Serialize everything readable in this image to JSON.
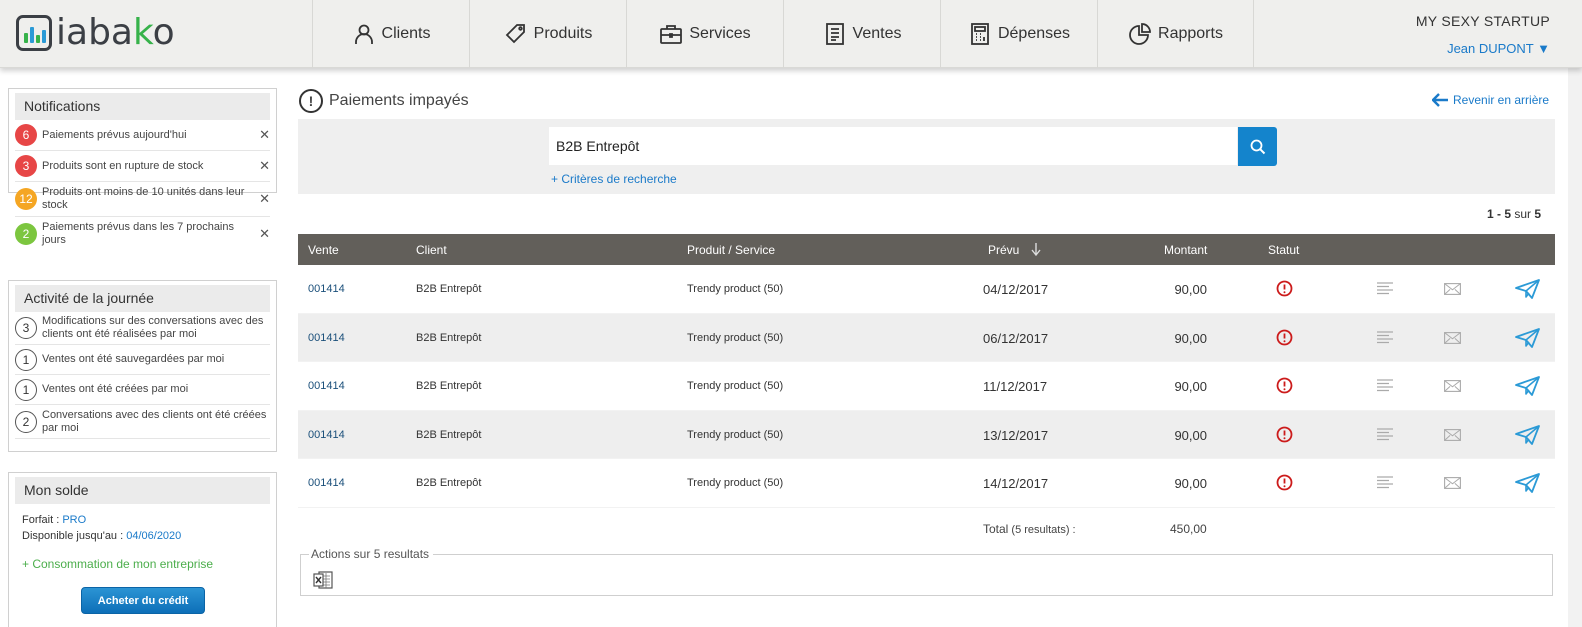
{
  "app": {
    "logo_text_1": "iaba",
    "logo_text_2": "k",
    "logo_text_3": "o"
  },
  "colors": {
    "accent_blue": "#1484cc",
    "header_bg": "#efefed",
    "table_header": "#625f5a",
    "badge_red": "#e74646",
    "badge_orange": "#f5a623",
    "badge_green": "#7cc63f",
    "status_red": "#cc1b1b",
    "send_blue": "#2b9ad6"
  },
  "nav": {
    "clients": "Clients",
    "produits": "Produits",
    "services": "Services",
    "ventes": "Ventes",
    "depenses": "Dépenses",
    "rapports": "Rapports"
  },
  "header": {
    "company": "MY SEXY STARTUP",
    "user": "Jean DUPONT ▼"
  },
  "notifications": {
    "title": "Notifications",
    "items": [
      {
        "count": "6",
        "text": "Paiements prévus aujourd'hui",
        "color": "#e74646"
      },
      {
        "count": "3",
        "text": "Produits sont en rupture de stock",
        "color": "#e74646"
      },
      {
        "count": "12",
        "text": "Produits ont moins de 10 unités dans leur stock",
        "color": "#f5a623"
      },
      {
        "count": "2",
        "text": "Paiements prévus dans les 7 prochains jours",
        "color": "#7cc63f"
      }
    ]
  },
  "activity": {
    "title": "Activité de la journée",
    "items": [
      {
        "count": "3",
        "text": "Modifications sur des conversations avec des clients ont été réalisées par moi"
      },
      {
        "count": "1",
        "text": "Ventes ont été sauvegardées par moi"
      },
      {
        "count": "1",
        "text": "Ventes ont été créées par moi"
      },
      {
        "count": "2",
        "text": "Conversations avec des clients ont été créées par moi"
      }
    ]
  },
  "solde": {
    "title": "Mon solde",
    "forfait_label": "Forfait : ",
    "forfait_value": "PRO",
    "dispo_label": "Disponible jusqu'au : ",
    "dispo_value": "04/06/2020",
    "conso": "+ Consommation de mon entreprise",
    "buy": "Acheter du crédit"
  },
  "main": {
    "title": "Paiements impayés",
    "back": "Revenir en arrière",
    "search_value": "B2B Entrepôt",
    "criteria": "+ Critères de recherche",
    "pagination": {
      "range": "1 - 5",
      "sep": " sur ",
      "total": "5"
    }
  },
  "table": {
    "headers": {
      "vente": "Vente",
      "client": "Client",
      "produit": "Produit / Service",
      "prevu": "Prévu",
      "montant": "Montant",
      "statut": "Statut"
    },
    "rows": [
      {
        "vente": "001414",
        "client": "B2B Entrepôt",
        "produit": "Trendy product (50)",
        "prevu": "04/12/2017",
        "montant": "90,00"
      },
      {
        "vente": "001414",
        "client": "B2B Entrepôt",
        "produit": "Trendy product (50)",
        "prevu": "06/12/2017",
        "montant": "90,00"
      },
      {
        "vente": "001414",
        "client": "B2B Entrepôt",
        "produit": "Trendy product (50)",
        "prevu": "11/12/2017",
        "montant": "90,00"
      },
      {
        "vente": "001414",
        "client": "B2B Entrepôt",
        "produit": "Trendy product (50)",
        "prevu": "13/12/2017",
        "montant": "90,00"
      },
      {
        "vente": "001414",
        "client": "B2B Entrepôt",
        "produit": "Trendy product (50)",
        "prevu": "14/12/2017",
        "montant": "90,00"
      }
    ],
    "total_label": "Total",
    "total_count": " (5 resultats) :",
    "total_value": "450,00"
  },
  "actions": {
    "legend": "Actions sur 5 resultats"
  }
}
